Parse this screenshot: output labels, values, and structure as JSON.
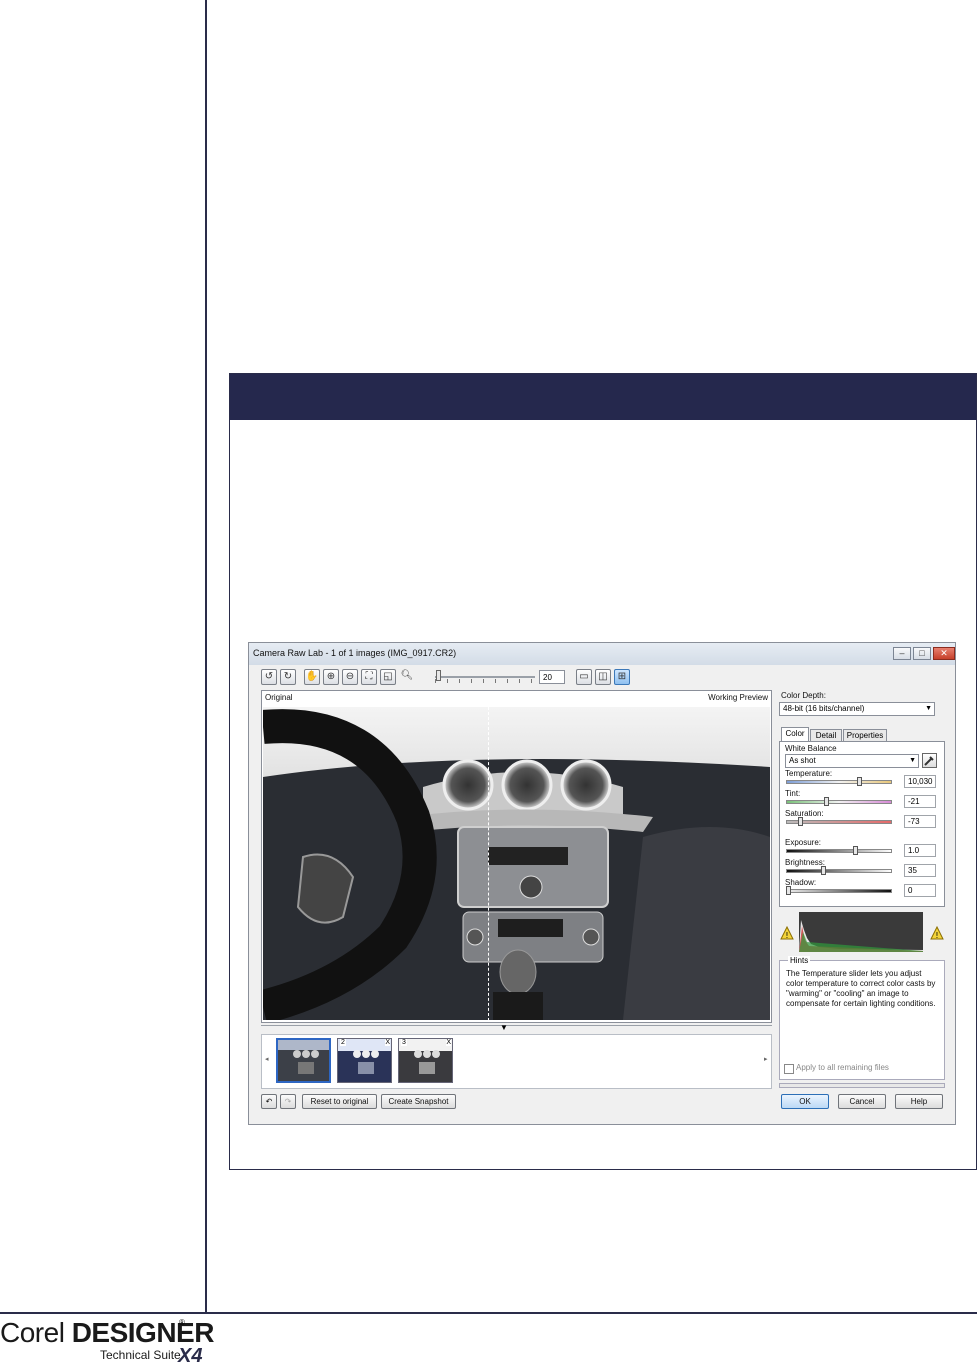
{
  "logo": {
    "brand_light": "Corel ",
    "brand_bold": "DESIGNER",
    "registered": "®",
    "subtitle": "Technical Suite",
    "version": "X4"
  },
  "dialog": {
    "title": "Camera Raw Lab - 1 of 1 images (IMG_0917.CR2)",
    "window_buttons": [
      "minimize-icon",
      "maximize-icon",
      "close-icon"
    ],
    "toolbar": {
      "icons": [
        "rotate-left-icon",
        "rotate-right-icon",
        "pan-hand-icon",
        "zoom-in-icon",
        "zoom-out-icon",
        "fit-to-window-icon",
        "actual-size-icon",
        "zoom-tool-icon"
      ],
      "zoom_value": "20",
      "view_icons": [
        "single-view-icon",
        "split-view-icon",
        "side-by-side-view-icon"
      ]
    },
    "preview": {
      "original_label": "Original",
      "working_label": "Working Preview"
    },
    "filmstrip": {
      "thumbnails": [
        {
          "number": "",
          "close": ""
        },
        {
          "number": "2",
          "close": "X"
        },
        {
          "number": "3",
          "close": "X"
        }
      ]
    },
    "bottom": {
      "reset_label": "Reset to original",
      "snapshot_label": "Create Snapshot"
    },
    "side": {
      "color_depth_label": "Color Depth:",
      "color_depth_value": "48-bit (16 bits/channel)",
      "tabs": [
        "Color",
        "Detail",
        "Properties"
      ],
      "white_balance_label": "White Balance",
      "white_balance_value": "As shot",
      "sliders": [
        {
          "label": "Temperature:",
          "value": "10,030",
          "level": 0.7,
          "gradient": "linear-gradient(90deg,#7e9ed6,#f2f2f2,#e8c77a)"
        },
        {
          "label": "Tint:",
          "value": "-21",
          "level": 0.38,
          "gradient": "linear-gradient(90deg,#7ac27a,#f2f2f2,#d78ad6)"
        },
        {
          "label": "Saturation:",
          "value": "-73",
          "level": 0.12,
          "gradient": "linear-gradient(90deg,#bbbbbb,#e56a6a)"
        },
        {
          "label": "Exposure:",
          "value": "1.0",
          "level": 0.66,
          "gradient": "linear-gradient(90deg,#111,#fff)"
        },
        {
          "label": "Brightness:",
          "value": "35",
          "level": 0.35,
          "gradient": "linear-gradient(90deg,#111,#fff)"
        },
        {
          "label": "Shadow:",
          "value": "0",
          "level": 0.0,
          "gradient": "linear-gradient(90deg,#eee,#111)"
        }
      ],
      "hints_title": "Hints",
      "hints_text": "The Temperature slider lets you adjust color temperature to correct color casts by \"warming\" or \"cooling\" an image to compensate for certain lighting conditions.",
      "apply_all_label": "Apply to all remaining files"
    },
    "footer": {
      "ok": "OK",
      "cancel": "Cancel",
      "help": "Help"
    }
  },
  "colors": {
    "rule": "#2a2c4a",
    "panel_header": "#25284d",
    "selection": "#2d66c3"
  }
}
